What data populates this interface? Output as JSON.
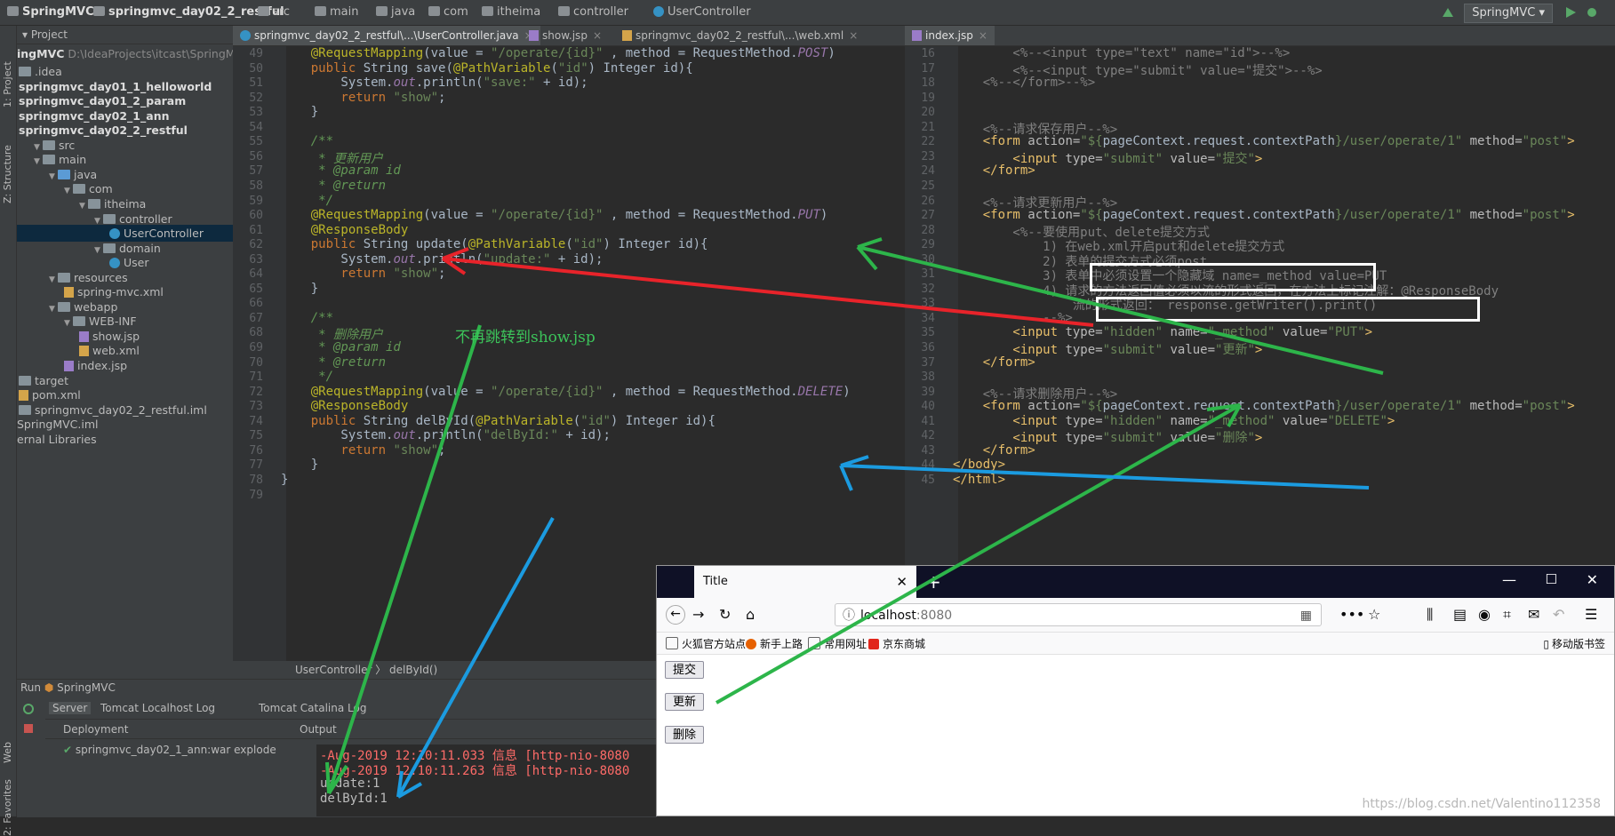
{
  "breadcrumb": [
    "SpringMVC",
    "springmvc_day02_2_restful",
    "src",
    "main",
    "java",
    "com",
    "itheima",
    "controller",
    "UserController"
  ],
  "run_config": "SpringMVC",
  "left_strip": {
    "project": "1: Project",
    "structure": "Z: Structure",
    "web": "Web",
    "favorites": "2: Favorites"
  },
  "project_panel": {
    "title": "Project",
    "root": "ingMVC",
    "root_path": "D:\\IdeaProjects\\itcast\\SpringMV",
    "items": [
      {
        "label": ".idea",
        "depth": 0,
        "icon": "folder",
        "bold": false
      },
      {
        "label": "springmvc_day01_1_helloworld",
        "depth": 0,
        "icon": "none",
        "bold": true
      },
      {
        "label": "springmvc_day01_2_param",
        "depth": 0,
        "icon": "none",
        "bold": true
      },
      {
        "label": "springmvc_day02_1_ann",
        "depth": 0,
        "icon": "none",
        "bold": true
      },
      {
        "label": "springmvc_day02_2_restful",
        "depth": 0,
        "icon": "none",
        "bold": true
      },
      {
        "label": "src",
        "depth": 1,
        "icon": "folder",
        "bold": false
      },
      {
        "label": "main",
        "depth": 1,
        "icon": "folder",
        "bold": false
      },
      {
        "label": "java",
        "depth": 2,
        "icon": "java",
        "bold": false
      },
      {
        "label": "com",
        "depth": 3,
        "icon": "folder",
        "bold": false
      },
      {
        "label": "itheima",
        "depth": 4,
        "icon": "folder",
        "bold": false
      },
      {
        "label": "controller",
        "depth": 5,
        "icon": "folder",
        "bold": false
      },
      {
        "label": "UserController",
        "depth": 6,
        "icon": "class",
        "bold": false,
        "selected": true
      },
      {
        "label": "domain",
        "depth": 5,
        "icon": "folder",
        "bold": false
      },
      {
        "label": "User",
        "depth": 6,
        "icon": "class",
        "bold": false
      },
      {
        "label": "resources",
        "depth": 2,
        "icon": "folder",
        "bold": false
      },
      {
        "label": "spring-mvc.xml",
        "depth": 3,
        "icon": "xml",
        "bold": false
      },
      {
        "label": "webapp",
        "depth": 2,
        "icon": "folder",
        "bold": false
      },
      {
        "label": "WEB-INF",
        "depth": 3,
        "icon": "folder",
        "bold": false
      },
      {
        "label": "show.jsp",
        "depth": 4,
        "icon": "jsp",
        "bold": false
      },
      {
        "label": "web.xml",
        "depth": 4,
        "icon": "xml",
        "bold": false
      },
      {
        "label": "index.jsp",
        "depth": 3,
        "icon": "jsp",
        "bold": false
      },
      {
        "label": "target",
        "depth": 0,
        "icon": "folder",
        "bold": false
      },
      {
        "label": "pom.xml",
        "depth": 0,
        "icon": "xml",
        "bold": false
      },
      {
        "label": "springmvc_day02_2_restful.iml",
        "depth": 0,
        "icon": "file",
        "bold": false
      },
      {
        "label": "SpringMVC.iml",
        "depth": -1,
        "icon": "none",
        "bold": false
      },
      {
        "label": "ernal Libraries",
        "depth": -1,
        "icon": "none",
        "bold": false
      }
    ]
  },
  "left_tabs": [
    "springmvc_day02_2_restful\\...\\UserController.java",
    "show.jsp",
    "springmvc_day02_2_restful\\...\\web.xml"
  ],
  "right_tabs": [
    "index.jsp"
  ],
  "java_start_line": 49,
  "java_lines": [
    [
      [
        "ann",
        "@RequestMapping"
      ],
      [
        "par",
        "(value = "
      ],
      [
        "str",
        "\"/operate/{id}\""
      ],
      [
        "par",
        " , method = RequestMethod."
      ],
      [
        "field",
        "POST"
      ],
      [
        "par",
        ")"
      ]
    ],
    [
      [
        "kw",
        "public "
      ],
      [
        "par",
        "String save("
      ],
      [
        "ann",
        "@PathVariable"
      ],
      [
        "par",
        "("
      ],
      [
        "str",
        "\"id\""
      ],
      [
        "par",
        ") Integer id){"
      ]
    ],
    [
      [
        "par",
        "    System."
      ],
      [
        "field",
        "out"
      ],
      [
        "par",
        ".println("
      ],
      [
        "str",
        "\"save:\""
      ],
      [
        "par",
        " + id);"
      ]
    ],
    [
      [
        "kw",
        "    return "
      ],
      [
        "str",
        "\"show\""
      ],
      [
        "par",
        ";"
      ]
    ],
    [
      [
        "par",
        "}"
      ]
    ],
    [
      [
        "par",
        ""
      ]
    ],
    [
      [
        "cmt",
        "/**"
      ]
    ],
    [
      [
        "cmt",
        " * 更新用户"
      ]
    ],
    [
      [
        "cmt",
        " * @param id"
      ]
    ],
    [
      [
        "cmt",
        " * @return"
      ]
    ],
    [
      [
        "cmt",
        " */"
      ]
    ],
    [
      [
        "ann",
        "@RequestMapping"
      ],
      [
        "par",
        "(value = "
      ],
      [
        "str",
        "\"/operate/{id}\""
      ],
      [
        "par",
        " , method = RequestMethod."
      ],
      [
        "field",
        "PUT"
      ],
      [
        "par",
        ")"
      ]
    ],
    [
      [
        "ann",
        "@ResponseBody"
      ]
    ],
    [
      [
        "kw",
        "public "
      ],
      [
        "par",
        "String update("
      ],
      [
        "ann",
        "@PathVariable"
      ],
      [
        "par",
        "("
      ],
      [
        "str",
        "\"id\""
      ],
      [
        "par",
        ") Integer id){"
      ]
    ],
    [
      [
        "par",
        "    System."
      ],
      [
        "field",
        "out"
      ],
      [
        "par",
        ".println("
      ],
      [
        "str",
        "\"update:\""
      ],
      [
        "par",
        " + id);"
      ]
    ],
    [
      [
        "kw",
        "    return "
      ],
      [
        "str",
        "\"show\""
      ],
      [
        "par",
        ";"
      ]
    ],
    [
      [
        "par",
        "}"
      ]
    ],
    [
      [
        "par",
        ""
      ]
    ],
    [
      [
        "cmt",
        "/**"
      ]
    ],
    [
      [
        "cmt",
        " * 删除用户"
      ]
    ],
    [
      [
        "cmt",
        " * @param id"
      ]
    ],
    [
      [
        "cmt",
        " * @return"
      ]
    ],
    [
      [
        "cmt",
        " */"
      ]
    ],
    [
      [
        "ann",
        "@RequestMapping"
      ],
      [
        "par",
        "(value = "
      ],
      [
        "str",
        "\"/operate/{id}\""
      ],
      [
        "par",
        " , method = RequestMethod."
      ],
      [
        "field",
        "DELETE"
      ],
      [
        "par",
        ")"
      ]
    ],
    [
      [
        "ann",
        "@ResponseBody"
      ]
    ],
    [
      [
        "kw",
        "public "
      ],
      [
        "par",
        "String delById("
      ],
      [
        "ann",
        "@PathVariable"
      ],
      [
        "par",
        "("
      ],
      [
        "str",
        "\"id\""
      ],
      [
        "par",
        ") Integer id){"
      ]
    ],
    [
      [
        "par",
        "    System."
      ],
      [
        "field",
        "out"
      ],
      [
        "par",
        ".println("
      ],
      [
        "str",
        "\"delById:\""
      ],
      [
        "par",
        " + id);"
      ]
    ],
    [
      [
        "kw",
        "    return "
      ],
      [
        "str",
        "\"show\""
      ],
      [
        "par",
        ";"
      ]
    ],
    [
      [
        "par",
        "}"
      ]
    ],
    [
      [
        "par",
        "}"
      ]
    ],
    [
      [
        "par",
        ""
      ]
    ]
  ],
  "java_indent": [
    "    ",
    "    ",
    "    ",
    "    ",
    "    ",
    "",
    "    ",
    "    ",
    "    ",
    "    ",
    "    ",
    "    ",
    "    ",
    "    ",
    "    ",
    "    ",
    "    ",
    "",
    "    ",
    "    ",
    "    ",
    "    ",
    "    ",
    "    ",
    "    ",
    "    ",
    "    ",
    "    ",
    "    ",
    "",
    ""
  ],
  "jsp_start_line": 16,
  "jsp_lines": [
    [
      [
        "jcmt",
        "        <%--<input type=\"text\" name=\"id\">--%>"
      ]
    ],
    [
      [
        "jcmt",
        "        <%--<input type=\"submit\" value=\"提交\">--%>"
      ]
    ],
    [
      [
        "jcmt",
        "    <%--</form>--%>"
      ]
    ],
    [
      [
        "par",
        ""
      ]
    ],
    [
      [
        "par",
        ""
      ]
    ],
    [
      [
        "jcmt",
        "    <%--请求保存用户--%>"
      ]
    ],
    [
      [
        "tag",
        "    <form "
      ],
      [
        "attr",
        "action="
      ],
      [
        "str",
        "\"${"
      ],
      [
        "par",
        "pageContext.request.contextPath"
      ],
      [
        "str",
        "}/user/operate/1\""
      ],
      [
        "attr",
        " method="
      ],
      [
        "str",
        "\"post\""
      ],
      [
        "tag",
        ">"
      ]
    ],
    [
      [
        "tag",
        "        <input "
      ],
      [
        "attr",
        "type="
      ],
      [
        "str",
        "\"submit\""
      ],
      [
        "attr",
        " value="
      ],
      [
        "str",
        "\"提交\""
      ],
      [
        "tag",
        ">"
      ]
    ],
    [
      [
        "tag",
        "    </form>"
      ]
    ],
    [
      [
        "par",
        ""
      ]
    ],
    [
      [
        "jcmt",
        "    <%--请求更新用户--%>"
      ]
    ],
    [
      [
        "tag",
        "    <form "
      ],
      [
        "attr",
        "action="
      ],
      [
        "str",
        "\"${"
      ],
      [
        "par",
        "pageContext.request.contextPath"
      ],
      [
        "str",
        "}/user/operate/1\""
      ],
      [
        "attr",
        " method="
      ],
      [
        "str",
        "\"post\""
      ],
      [
        "tag",
        ">"
      ]
    ],
    [
      [
        "jcmt",
        "        <%--要使用put、delete提交方式"
      ]
    ],
    [
      [
        "jcmt",
        "            1) 在web.xml开启put和delete提交方式"
      ]
    ],
    [
      [
        "jcmt",
        "            2) 表单的提交方式必须post"
      ]
    ],
    [
      [
        "jcmt",
        "            3) 表单中必须设置一个隐藏域 name=_method value=PUT"
      ]
    ],
    [
      [
        "jcmt",
        "            4) 请求的方法返回值必须以流的形式返回，在方法上标记注解：@ResponseBody"
      ]
    ],
    [
      [
        "jcmt",
        "                流的形式返回： response.getWriter().print()"
      ]
    ],
    [
      [
        "jcmt",
        "            --%>"
      ]
    ],
    [
      [
        "tag",
        "        <input "
      ],
      [
        "attr",
        "type="
      ],
      [
        "str",
        "\"hidden\""
      ],
      [
        "attr",
        " name="
      ],
      [
        "str",
        "\"_method\""
      ],
      [
        "attr",
        " value="
      ],
      [
        "str",
        "\"PUT\""
      ],
      [
        "tag",
        ">"
      ]
    ],
    [
      [
        "tag",
        "        <input "
      ],
      [
        "attr",
        "type="
      ],
      [
        "str",
        "\"submit\""
      ],
      [
        "attr",
        " value="
      ],
      [
        "str",
        "\"更新\""
      ],
      [
        "tag",
        ">"
      ]
    ],
    [
      [
        "tag",
        "    </form>"
      ]
    ],
    [
      [
        "par",
        ""
      ]
    ],
    [
      [
        "jcmt",
        "    <%--请求删除用户--%>"
      ]
    ],
    [
      [
        "tag",
        "    <form "
      ],
      [
        "attr",
        "action="
      ],
      [
        "str",
        "\"${"
      ],
      [
        "par",
        "pageContext.request.contextPath"
      ],
      [
        "str",
        "}/user/operate/1\""
      ],
      [
        "attr",
        " method="
      ],
      [
        "str",
        "\"post\""
      ],
      [
        "tag",
        ">"
      ]
    ],
    [
      [
        "tag",
        "        <input "
      ],
      [
        "attr",
        "type="
      ],
      [
        "str",
        "\"hidden\""
      ],
      [
        "attr",
        " name="
      ],
      [
        "str",
        "\"_method\""
      ],
      [
        "attr",
        " value="
      ],
      [
        "str",
        "\"DELETE\""
      ],
      [
        "tag",
        ">"
      ]
    ],
    [
      [
        "tag",
        "        <input "
      ],
      [
        "attr",
        "type="
      ],
      [
        "str",
        "\"submit\""
      ],
      [
        "attr",
        " value="
      ],
      [
        "str",
        "\"删除\""
      ],
      [
        "tag",
        ">"
      ]
    ],
    [
      [
        "tag",
        "    </form>"
      ]
    ],
    [
      [
        "tag",
        "</body>"
      ]
    ],
    [
      [
        "tag",
        "</html>"
      ]
    ]
  ],
  "editor_breadcrumb": [
    "UserController",
    "delById()"
  ],
  "run_panel": {
    "title": "Run",
    "config": "SpringMVC",
    "tabs": [
      "Server",
      "Tomcat Localhost Log",
      "Tomcat Catalina Log"
    ],
    "deployment_label": "Deployment",
    "output_label": "Output",
    "deployment_item": "springmvc_day02_1_ann:war explode",
    "console": [
      {
        "text": "-Aug-2019 12:10:11.033 信息 [http-nio-8080",
        "color": "#ff6b68"
      },
      {
        "text": "-Aug-2019 12:10:11.263 信息 [http-nio-8080",
        "color": "#ff6b68"
      },
      {
        "text": "update:1",
        "color": "#bbbbbb"
      },
      {
        "text": "delById:1",
        "color": "#bbbbbb"
      }
    ]
  },
  "browser": {
    "tab_title": "Title",
    "url_host": "localhost",
    "url_port": ":8080",
    "bookmarks": [
      "火狐官方站点",
      "新手上路",
      "常用网址",
      "京东商城"
    ],
    "mobile_bookmarks": "移动版书签",
    "buttons": [
      "提交",
      "更新",
      "删除"
    ]
  },
  "annotation_text": "不再跳转到show.jsp",
  "watermark": "https://blog.csdn.net/Valentino112358",
  "colors": {
    "red_arrow": "#e8232a",
    "green_arrow": "#2db54a",
    "blue_arrow": "#1b9be0"
  }
}
